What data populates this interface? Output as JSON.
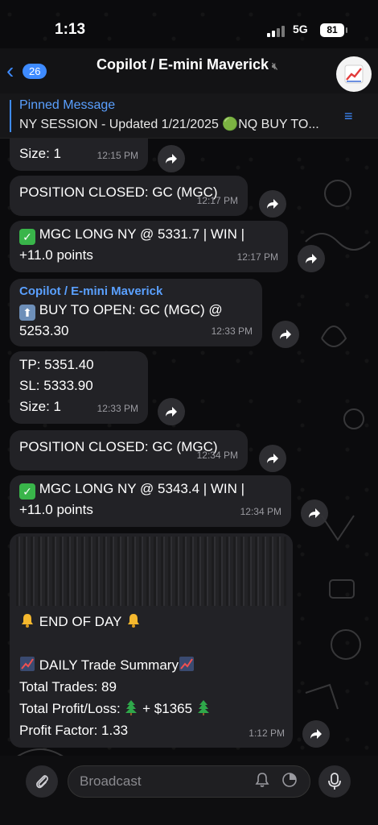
{
  "status_bar": {
    "time": "1:13",
    "network": "5G",
    "battery": "81"
  },
  "header": {
    "back_count": "26",
    "title": "Copilot / E-mini Maverick"
  },
  "pinned": {
    "label": "Pinned Message",
    "text": "NY SESSION - Updated 1/21/2025 🟢NQ BUY TO..."
  },
  "messages": [
    {
      "text": "Size: 1",
      "time": "12:15 PM"
    },
    {
      "text": "POSITION CLOSED: GC (MGC)",
      "time": "12:17 PM"
    },
    {
      "line1": "MGC LONG NY @ 5331.7 | WIN |",
      "line2": "+11.0 points",
      "time": "12:17 PM"
    },
    {
      "sender": "Copilot / E-mini Maverick",
      "line1": "BUY TO OPEN: GC (MGC) @",
      "line2": "5253.30",
      "time": "12:33 PM"
    },
    {
      "line1": "TP: 5351.40",
      "line2": "SL: 5333.90",
      "line3": "Size: 1",
      "time": "12:33 PM"
    },
    {
      "text": "POSITION CLOSED: GC (MGC)",
      "time": "12:34 PM"
    },
    {
      "line1": "MGC LONG NY @ 5343.4 | WIN |",
      "line2": "+11.0 points",
      "time": "12:34 PM"
    }
  ],
  "summary": {
    "end_of_day": "END OF DAY",
    "daily": "DAILY Trade Summary",
    "total_trades": "Total Trades: 89",
    "pnl_label": "Total Profit/Loss:",
    "pnl_value": "+ $1365",
    "profit_factor": "Profit Factor: 1.33",
    "time": "1:12 PM"
  },
  "input": {
    "placeholder": "Broadcast"
  },
  "colors": {
    "accent": "#3e8bff",
    "bubble": "#222226",
    "check": "#39b54a"
  }
}
